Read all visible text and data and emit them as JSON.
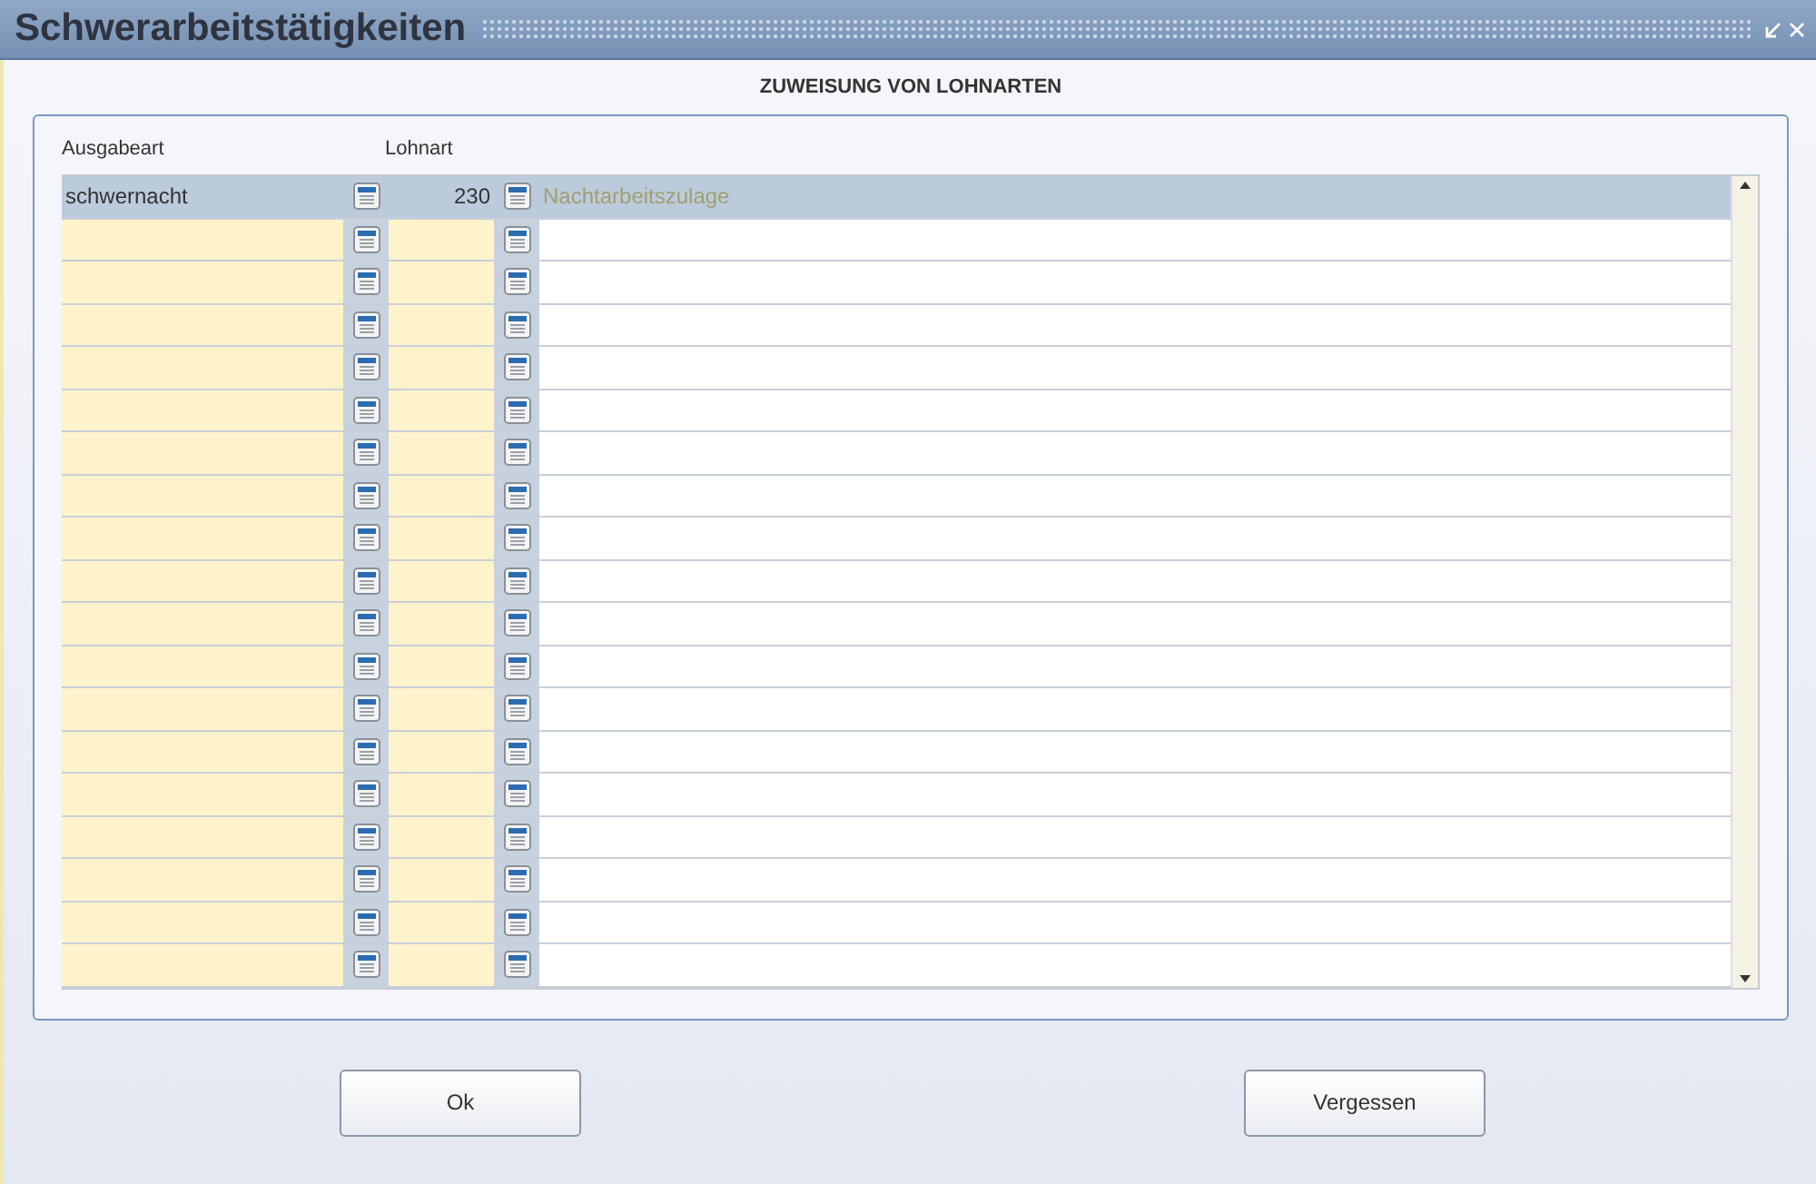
{
  "window": {
    "title": "Schwerarbeitstätigkeiten"
  },
  "panel": {
    "heading": "ZUWEISUNG VON LOHNARTEN"
  },
  "table": {
    "columns": [
      "Ausgabeart",
      "Lohnart"
    ],
    "rows": [
      {
        "ausgabeart": "schwernacht",
        "lohnart": "230",
        "bezeichnung": "Nachtarbeitszulage",
        "selected": true
      },
      {
        "selected": false
      },
      {
        "selected": false
      },
      {
        "selected": false
      },
      {
        "selected": false
      },
      {
        "selected": false
      },
      {
        "selected": false
      },
      {
        "selected": false
      },
      {
        "selected": false
      },
      {
        "selected": false
      },
      {
        "selected": false
      },
      {
        "selected": false
      },
      {
        "selected": false
      },
      {
        "selected": false
      },
      {
        "selected": false
      },
      {
        "selected": false
      },
      {
        "selected": false
      },
      {
        "selected": false
      },
      {
        "selected": false
      }
    ]
  },
  "buttons": [
    "Ok",
    "Vergessen"
  ]
}
